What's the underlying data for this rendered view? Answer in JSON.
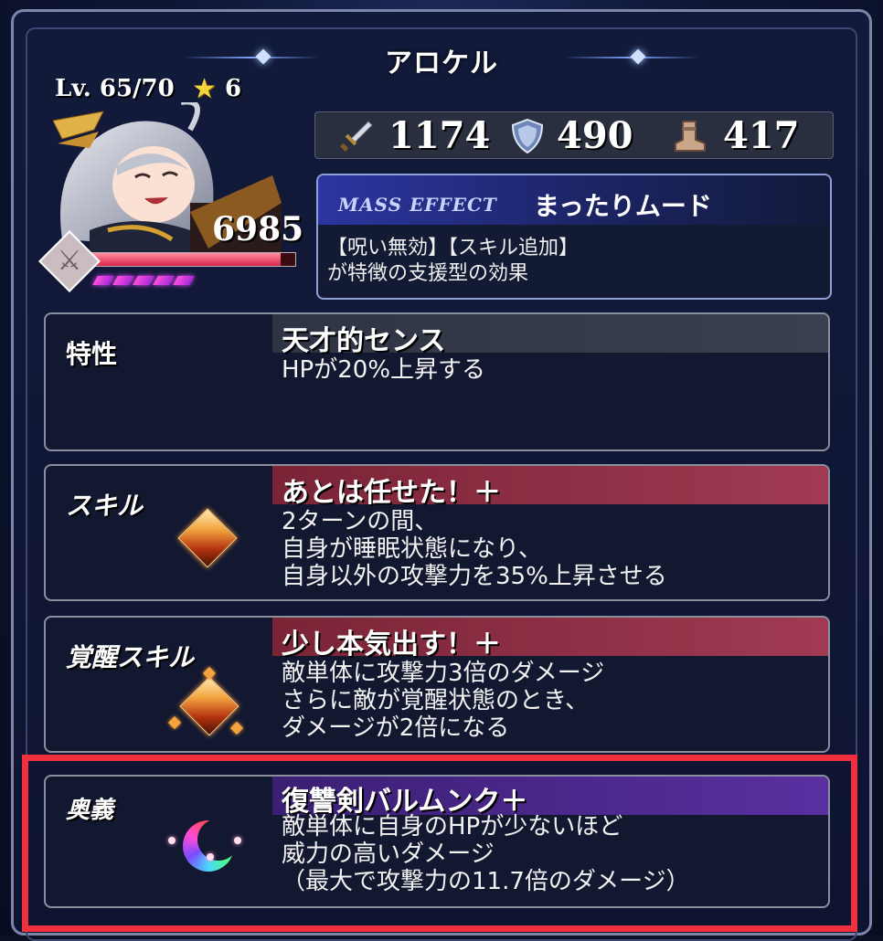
{
  "title": "アロケル",
  "character": {
    "level_text": "Lv. 65/70",
    "stars": "6",
    "hp": "6985",
    "hp_fraction": 0.93,
    "gauge_segments": 5
  },
  "stats": {
    "attack": "1174",
    "defense": "490",
    "speed": "417"
  },
  "mass_effect": {
    "label": "MASS EFFECT",
    "name": "まったりムード",
    "desc_line1": "【呪い無効】【スキル追加】",
    "desc_line2": "が特徴の支援型の効果"
  },
  "trait": {
    "label": "特性",
    "name": "天才的センス",
    "desc": "HPが20%上昇する"
  },
  "skill": {
    "label": "スキル",
    "name": "あとは任せた！＋",
    "desc": "2ターンの間、\n自身が睡眠状態になり、\n自身以外の攻撃力を35%上昇させる"
  },
  "awakened_skill": {
    "label": "覚醒スキル",
    "name": "少し本気出す！＋",
    "desc": "敵単体に攻撃力3倍のダメージ\nさらに敵が覚醒状態のとき、\nダメージが2倍になる"
  },
  "ultimate": {
    "label": "奥義",
    "name": "復讐剣バルムンク＋",
    "desc": "敵単体に自身のHPが少ないほど\n威力の高いダメージ\n（最大で攻撃力の11.7倍のダメージ）"
  },
  "colors": {
    "skill_band": "#7a2436",
    "ultimate_band": "#3a1f73",
    "highlight": "#f0303f"
  }
}
